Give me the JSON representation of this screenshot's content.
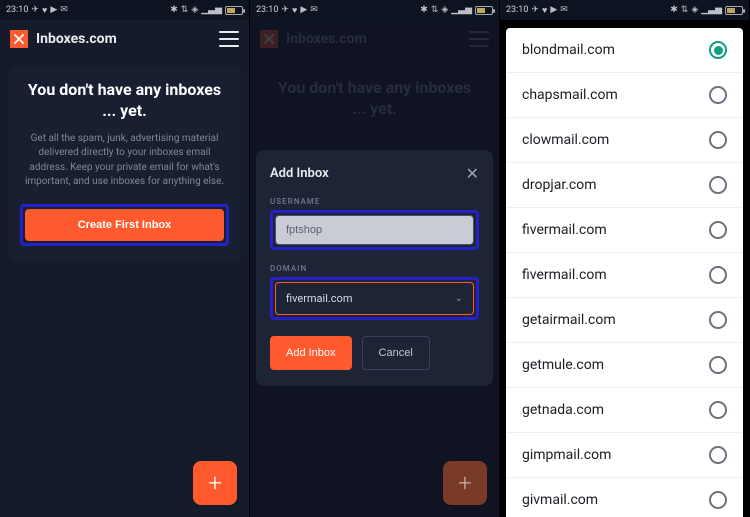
{
  "status_bar": {
    "time": "23:10",
    "icons_left": [
      "telegram-icon",
      "heart-icon",
      "youtube-icon",
      "chat-icon"
    ],
    "icons_right": [
      "bluetooth-icon",
      "data-icon",
      "wifi-icon",
      "signal-icon",
      "signal2-icon"
    ]
  },
  "app": {
    "title": "Inboxes.com",
    "logo_char": "✕"
  },
  "screen1": {
    "empty_title": "You don't have any inboxes ... yet.",
    "empty_desc": "Get all the spam, junk, advertising material delivered directly to your inboxes email address. Keep your private email for what's important, and use inboxes for anything else.",
    "cta": "Create First Inbox",
    "fab": "+"
  },
  "screen2": {
    "empty_title_dim": "You don't have any inboxes ... yet.",
    "modal_title": "Add Inbox",
    "username_label": "USERNAME",
    "username_value": "fptshop",
    "domain_label": "DOMAIN",
    "domain_value": "fivermail.com",
    "add_button": "Add Inbox",
    "cancel_button": "Cancel",
    "fab": "+"
  },
  "screen3": {
    "domains": [
      {
        "label": "blondmail.com",
        "selected": true
      },
      {
        "label": "chapsmail.com",
        "selected": false
      },
      {
        "label": "clowmail.com",
        "selected": false
      },
      {
        "label": "dropjar.com",
        "selected": false
      },
      {
        "label": "fivermail.com",
        "selected": false
      },
      {
        "label": "fivermail.com",
        "selected": false
      },
      {
        "label": "getairmail.com",
        "selected": false
      },
      {
        "label": "getmule.com",
        "selected": false
      },
      {
        "label": "getnada.com",
        "selected": false
      },
      {
        "label": "gimpmail.com",
        "selected": false
      },
      {
        "label": "givmail.com",
        "selected": false
      }
    ]
  }
}
